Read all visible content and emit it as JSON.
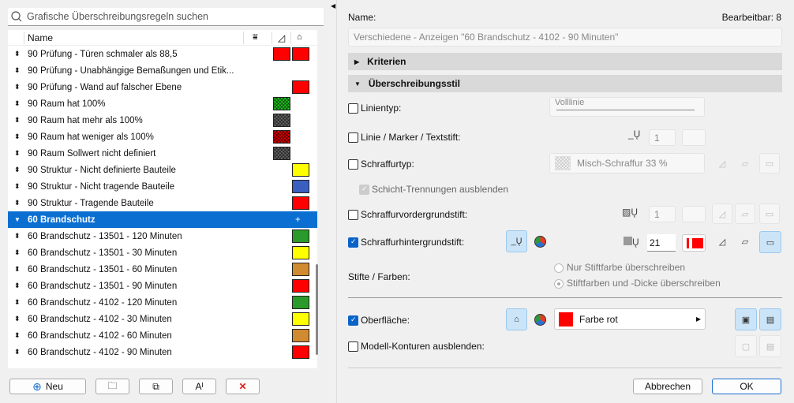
{
  "search": {
    "placeholder": "Grafische Überschreibungsregeln suchen"
  },
  "list": {
    "header": "Name",
    "rows": [
      {
        "label": "90 Prüfung - Türen schmaler als 88,5",
        "a": "#ff0000",
        "b": "#ff0000"
      },
      {
        "label": "90 Prüfung - Unabhängige Bemaßungen und Etik...",
        "a": null,
        "b": null
      },
      {
        "label": "90 Prüfung - Wand auf falscher Ebene",
        "a": null,
        "b": "#ff0000"
      },
      {
        "label": "90 Raum hat 100%",
        "a": "#1ec81e",
        "ah": true,
        "b": null
      },
      {
        "label": "90 Raum hat mehr als 100%",
        "a": "#666666",
        "ah": true,
        "b": null
      },
      {
        "label": "90 Raum hat weniger als 100%",
        "a": "#e00000",
        "ah": true,
        "b": null
      },
      {
        "label": "90 Raum Sollwert nicht definiert",
        "a": "#666666",
        "ah": true,
        "b": null
      },
      {
        "label": "90 Struktur - Nicht definierte Bauteile",
        "a": null,
        "b": "#ffff00"
      },
      {
        "label": "90 Struktur - Nicht tragende Bauteile",
        "a": null,
        "b": "#3a5fc0"
      },
      {
        "label": "90 Struktur - Tragende Bauteile",
        "a": null,
        "b": "#ff0000"
      },
      {
        "label": "60 Brandschutz",
        "group": true,
        "selected": true
      },
      {
        "label": "60 Brandschutz - 13501 - 120 Minuten",
        "a": null,
        "b": "#2a9a2a"
      },
      {
        "label": "60 Brandschutz - 13501 - 30 Minuten",
        "a": null,
        "b": "#ffff00"
      },
      {
        "label": "60 Brandschutz - 13501 - 60 Minuten",
        "a": null,
        "b": "#d08a30"
      },
      {
        "label": "60 Brandschutz - 13501 - 90 Minuten",
        "a": null,
        "b": "#ff0000"
      },
      {
        "label": "60 Brandschutz - 4102 - 120 Minuten",
        "a": null,
        "b": "#2a9a2a"
      },
      {
        "label": "60 Brandschutz - 4102 - 30 Minuten",
        "a": null,
        "b": "#ffff00"
      },
      {
        "label": "60 Brandschutz - 4102 - 60 Minuten",
        "a": null,
        "b": "#d08a30"
      },
      {
        "label": "60 Brandschutz - 4102 - 90 Minuten",
        "a": null,
        "b": "#ff0000"
      }
    ]
  },
  "buttons": {
    "new": "Neu",
    "font": "Aᴵ",
    "delete": "✕"
  },
  "right": {
    "name_label": "Name:",
    "editable": "Bearbeitbar: 8",
    "name_value": "Verschiedene - Anzeigen \"60 Brandschutz - 4102 - 90 Minuten\"",
    "criteria": "Kriterien",
    "style": "Überschreibungsstil",
    "linetype": "Linientyp:",
    "linetype_value": "Volllinie",
    "linepen": "Linie / Marker / Textstift:",
    "linepen_value": "1",
    "filltype": "Schraffurtyp:",
    "filltype_value": "Misch-Schraffur 33 %",
    "hide_sep": "Schicht-Trennungen ausblenden",
    "fg_pen": "Schraffurvordergrundstift:",
    "fg_pen_value": "1",
    "bg_pen": "Schraffurhintergrundstift:",
    "bg_pen_value": "21",
    "pens_colors": "Stifte / Farben:",
    "radio1": "Nur Stiftfarbe überschreiben",
    "radio2": "Stiftfarben und -Dicke überschreiben",
    "surface": "Oberfläche:",
    "surface_value": "Farbe rot",
    "surface_color": "#ff0000",
    "hide_contours": "Modell-Konturen ausblenden:",
    "cancel": "Abbrechen",
    "ok": "OK"
  }
}
